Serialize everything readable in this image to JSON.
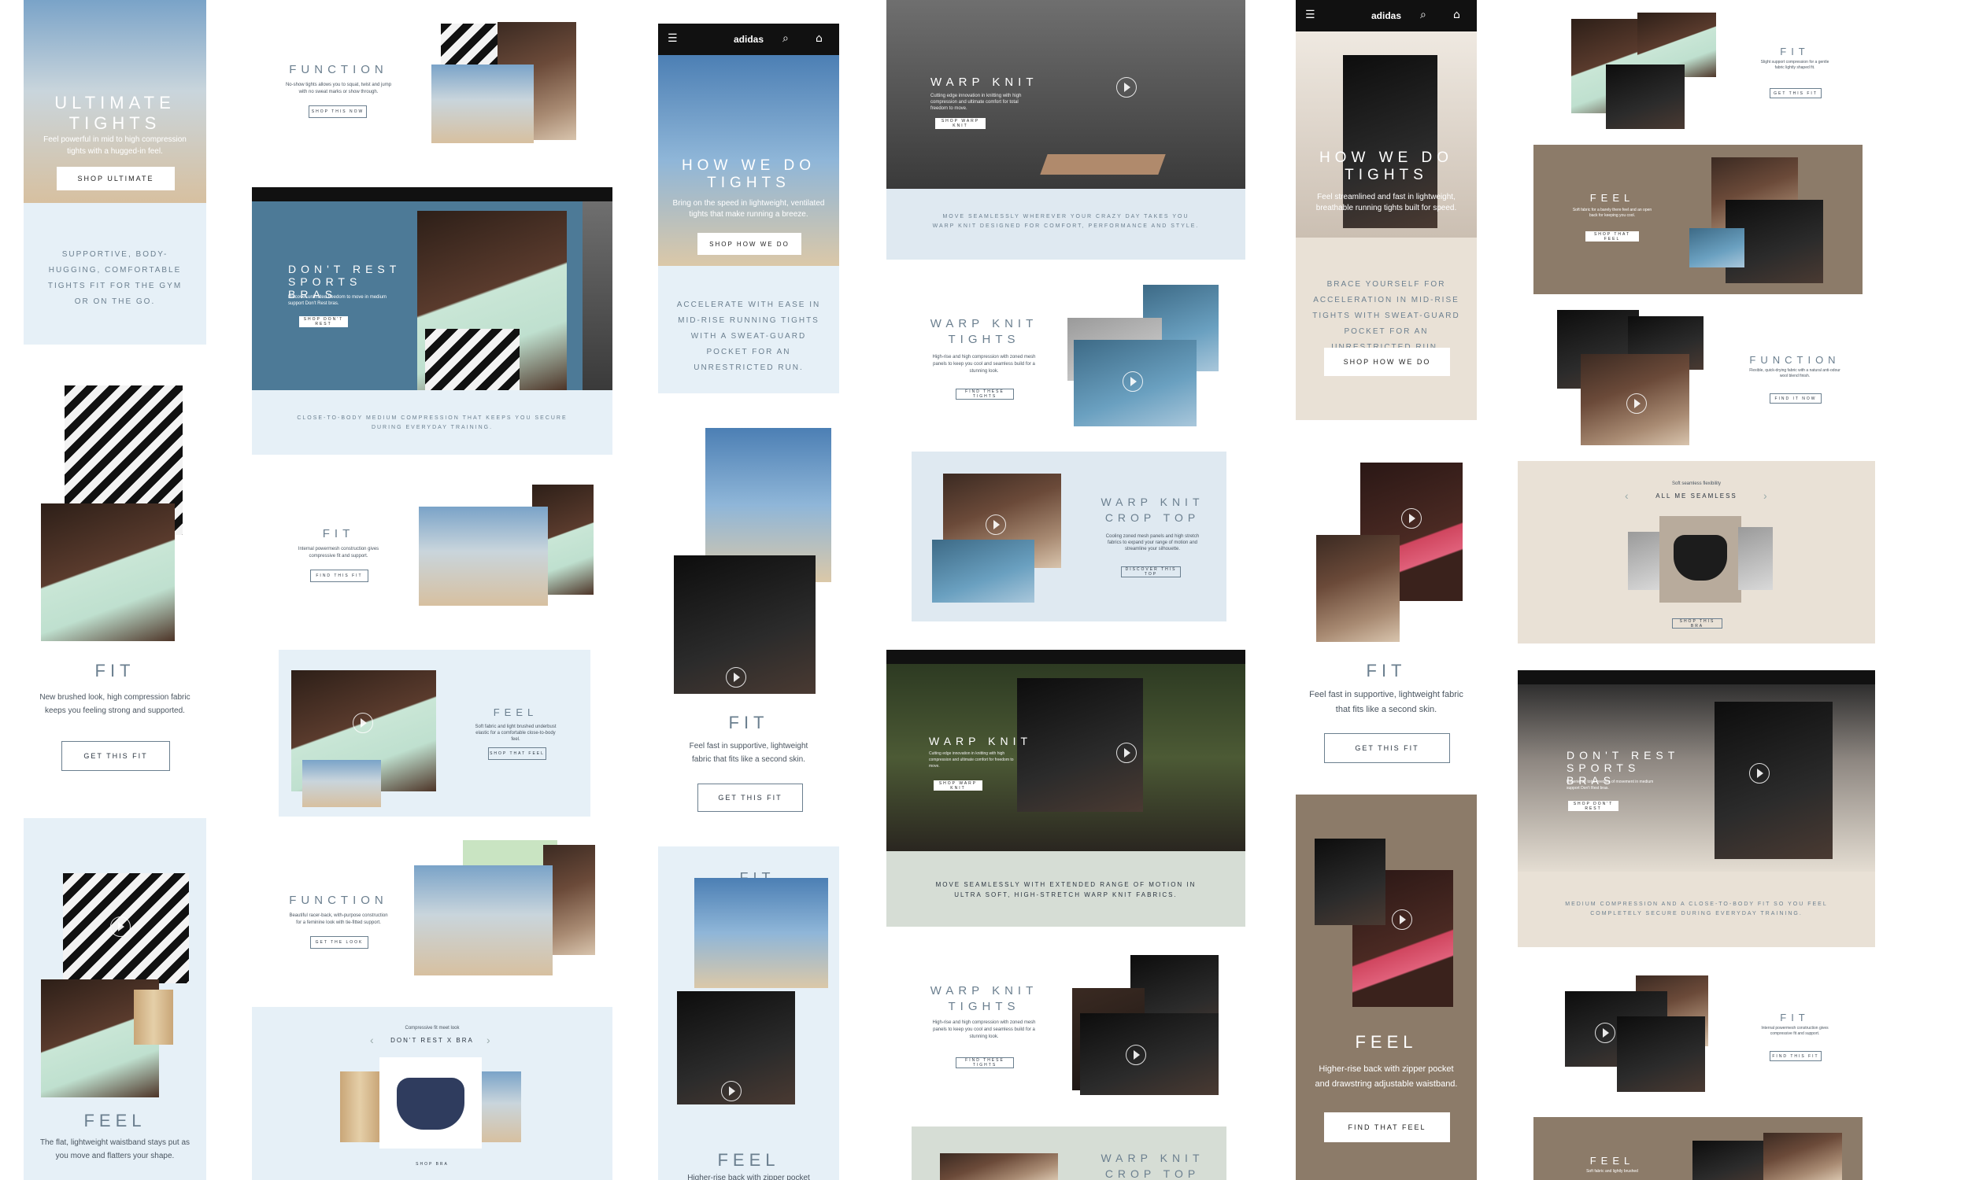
{
  "col1": {
    "hero_title": "ULTIMATE TIGHTS",
    "hero_body": "Feel powerful in mid to high compression tights with a hugged-in feel.",
    "hero_button": "SHOP ULTIMATE",
    "tagline": "SUPPORTIVE, BODY-HUGGING, COMFORTABLE TIGHTS FIT FOR THE GYM OR ON THE GO.",
    "fit_title": "FIT",
    "fit_body": "New brushed look, high compression fabric keeps you feeling strong and supported.",
    "fit_button": "GET THIS FIT",
    "feel_title": "FEEL",
    "feel_body": "The flat, lightweight waistband stays put as you move and flatters your shape."
  },
  "col2": {
    "function_title": "FUNCTION",
    "function_body": "No-show tights allows you to squat, twist and jump with no sweat marks or show through.",
    "function_button": "SHOP THIS NOW",
    "hero_title": "DON'T REST SPORTS BRAS",
    "hero_body": "Discover unlimited freedom to move in medium support Don't Rest bras.",
    "hero_button": "SHOP DON'T REST",
    "hero_tagline": "CLOSE-TO-BODY MEDIUM COMPRESSION THAT KEEPS YOU SECURE DURING EVERYDAY TRAINING.",
    "fit_title": "FIT",
    "fit_body": "Internal powermesh construction gives compressive fit and support.",
    "fit_button": "FIND THIS FIT",
    "feel_title": "FEEL",
    "feel_body": "Soft fabric and light brushed underbust elastic for a comfortable close-to-body feel.",
    "feel_button": "SHOP THAT FEEL",
    "function2_title": "FUNCTION",
    "function2_body": "Beautiful racer-back, with-purpose construction for a feminine look with tie-fitted support.",
    "function2_button": "GET THE LOOK",
    "carousel_kicker": "Compressive fit meet look",
    "carousel_title": "DON'T REST X BRA",
    "carousel_button": "SHOP BRA"
  },
  "col3": {
    "hero_title": "HOW WE DO TIGHTS",
    "hero_body": "Bring on the speed in lightweight, ventilated tights that make running a breeze.",
    "hero_button": "SHOP HOW WE DO",
    "tagline": "ACCELERATE WITH EASE IN MID-RISE RUNNING TIGHTS WITH A SWEAT-GUARD POCKET FOR AN UNRESTRICTED RUN.",
    "fit_title": "FIT",
    "fit_body": "Feel fast in supportive, lightweight fabric that fits like a second skin.",
    "fit_button": "GET THIS FIT",
    "fit2_title": "FIT",
    "feel_title": "FEEL",
    "feel_body": "Higher-rise back with zipper pocket"
  },
  "col4": {
    "hero_title": "WARP KNIT",
    "hero_body": "Cutting edge innovation in knitting with high compression and ultimate comfort for total freedom to move.",
    "hero_button": "SHOP WARP KNIT",
    "hero_tagline": "MOVE SEAMLESSLY WHEREVER YOUR CRAZY DAY TAKES YOU WARP KNIT DESIGNED FOR COMFORT, PERFORMANCE AND STYLE.",
    "tights_title": "WARP KNIT TIGHTS",
    "tights_body": "High-rise and high compression with zoned mesh panels to keep you cool and seamless build for a stunning look.",
    "tights_button": "FIND THESE TIGHTS",
    "crop_title": "WARP KNIT CROP TOP",
    "crop_body": "Cooling zoned mesh panels and high stretch fabrics to expand your range of motion and streamline your silhouette.",
    "crop_button": "DISCOVER THIS TOP",
    "desktop_title": "WARP KNIT",
    "desktop_body": "Cutting edge innovation in knitting with high compression and ultimate comfort for freedom to move.",
    "desktop_button": "SHOP WARP KNIT",
    "desktop_tagline": "MOVE SEAMLESSLY WITH EXTENDED RANGE OF MOTION IN ULTRA SOFT, HIGH-STRETCH WARP KNIT FABRICS.",
    "tights2_title": "WARP KNIT TIGHTS",
    "tights2_body": "High-rise and high compression with zoned mesh panels to keep you cool and seamless build for a stunning look.",
    "tights2_button": "FIND THESE TIGHTS",
    "crop2_title": "WARP KNIT CROP TOP"
  },
  "col5": {
    "hero_title": "HOW WE DO TIGHTS",
    "hero_body": "Feel streamlined and fast in lightweight, breathable running tights built for speed.",
    "tagline": "BRACE YOURSELF FOR ACCELERATION IN MID-RISE TIGHTS WITH SWEAT-GUARD POCKET FOR AN UNRESTRICTED RUN.",
    "tagline_button": "SHOP HOW WE DO",
    "fit_title": "FIT",
    "fit_body": "Feel fast in supportive, lightweight fabric that fits like a second skin.",
    "fit_button": "GET THIS FIT",
    "feel_title": "FEEL",
    "feel_body": "Higher-rise back with zipper pocket and drawstring adjustable waistband.",
    "feel_button": "FIND THAT FEEL"
  },
  "col6": {
    "fit_title": "FIT",
    "fit_body": "Slight support compression for a gentle fabric lightly shaped fit.",
    "fit_button": "GET THIS FIT",
    "feel_title": "FEEL",
    "feel_body": "Soft fabric for a barely there feel and an open back for keeping you cool.",
    "feel_button": "SHOP THAT FEEL",
    "function_title": "FUNCTION",
    "function_body": "Flexible, quick-drying fabric with a natural anti-odour wool blend finish.",
    "function_button": "FIND IT NOW",
    "carousel_kicker": "Soft seamless flexibility",
    "carousel_title": "ALL ME SEAMLESS",
    "carousel_button": "SHOP THIS BRA",
    "hero_title": "DON'T REST SPORTS BRAS",
    "hero_body": "Experience total freedom of movement in medium support Don't Rest bras.",
    "hero_button": "SHOP DON'T REST",
    "hero_tagline": "MEDIUM COMPRESSION AND A CLOSE-TO-BODY FIT SO YOU FEEL COMPLETELY SECURE DURING EVERYDAY TRAINING.",
    "fit2_title": "FIT",
    "fit2_body": "Internal powermesh construction gives compressive fit and support.",
    "fit2_button": "FIND THIS FIT",
    "feel2_title": "FEEL",
    "feel2_body": "Soft fabric and lightly brushed"
  },
  "nav": {
    "brand": "adidas",
    "menu_icon": "menu-icon",
    "search_icon": "search-icon",
    "bag_icon": "bag-icon"
  },
  "colors": {
    "pale_blue": "#e6f0f7",
    "sage": "#d6ddd5",
    "beige": "#e9e1d6",
    "taupe": "#8c7b69",
    "heading": "#6b7f8f"
  }
}
